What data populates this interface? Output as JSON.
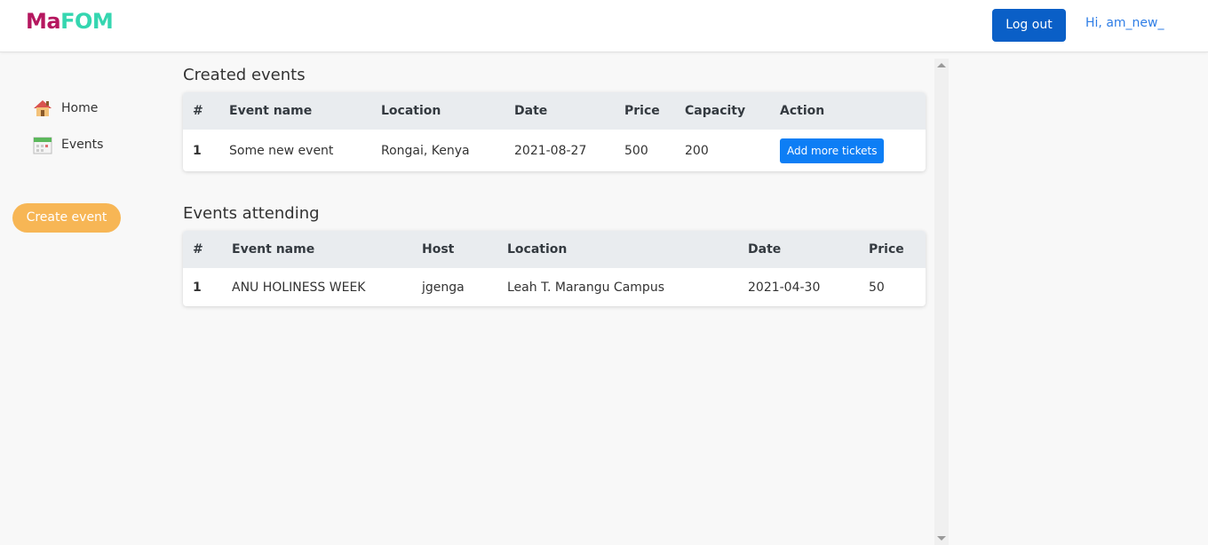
{
  "header": {
    "brand_part1": "Ma",
    "brand_part2": "FOM",
    "logout_label": "Log out",
    "greeting": "Hi, am_new_"
  },
  "sidebar": {
    "items": [
      {
        "label": "Home",
        "icon": "house-icon"
      },
      {
        "label": "Events",
        "icon": "calendar-icon"
      }
    ],
    "create_label": "Create event"
  },
  "created": {
    "title": "Created events",
    "headers": [
      "#",
      "Event name",
      "Location",
      "Date",
      "Price",
      "Capacity",
      "Action"
    ],
    "rows": [
      {
        "idx": "1",
        "name": "Some new event",
        "location": "Rongai, Kenya",
        "date": "2021-08-27",
        "price": "500",
        "capacity": "200",
        "action": "Add more tickets"
      }
    ]
  },
  "attending": {
    "title": "Events attending",
    "headers": [
      "#",
      "Event name",
      "Host",
      "Location",
      "Date",
      "Price"
    ],
    "rows": [
      {
        "idx": "1",
        "name": "ANU HOLINESS WEEK",
        "host": "jgenga",
        "location": "Leah T. Marangu Campus",
        "date": "2021-04-30",
        "price": "50"
      }
    ]
  },
  "colors": {
    "brand_primary": "#b5175f",
    "brand_secondary": "#35d6b0",
    "logout_button": "#0a5fc7",
    "create_button": "#f7b655",
    "action_button": "#0d7ef5"
  }
}
